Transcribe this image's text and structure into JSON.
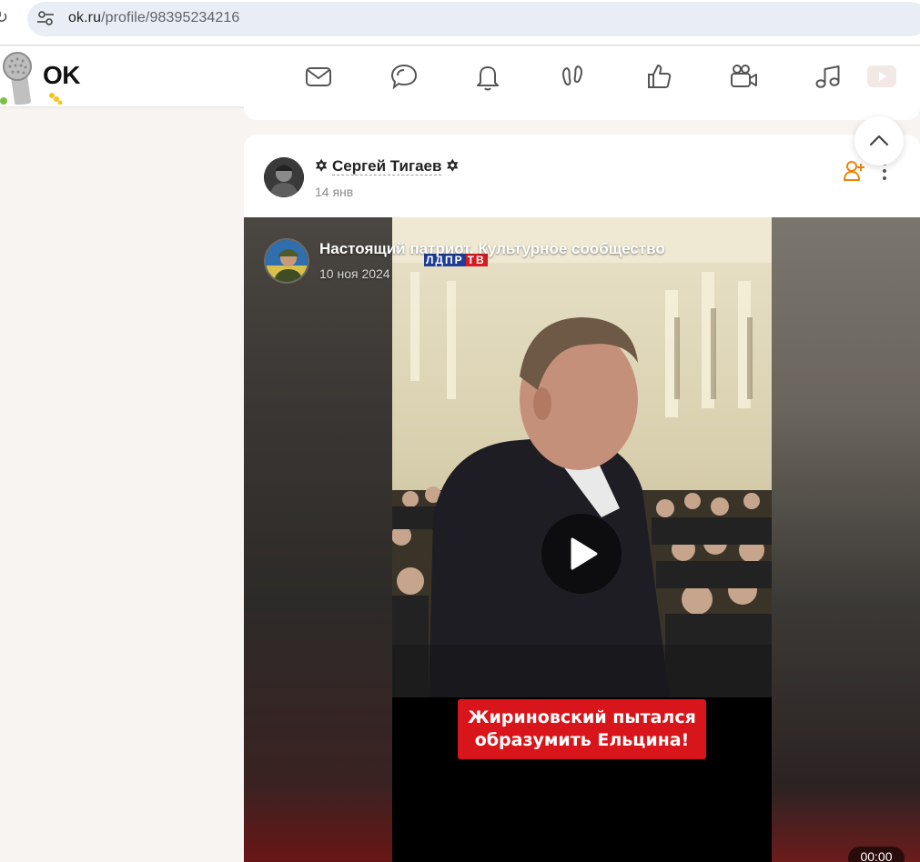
{
  "browser": {
    "url_domain": "ok.ru",
    "url_path": "/profile/98395234216"
  },
  "header": {
    "logo_text": "OK",
    "nav_icons": [
      "mail-icon",
      "discussions-icon",
      "notifications-icon",
      "guests-icon",
      "likes-icon",
      "video-icon",
      "music-icon",
      "video-tab-icon"
    ]
  },
  "post": {
    "author_name": "Сергей Тигаев",
    "author_decoration": "✡",
    "date": "14 янв",
    "video": {
      "group_name": "Настоящий патриот. Культурное сообщество",
      "group_date": "10 ноя 2024",
      "tv_badge_a": "ЛДПР",
      "tv_badge_b": "ТВ",
      "caption_line1": "Жириновский пытался",
      "caption_line2": "образумить Ельцина!",
      "duration": "00:00"
    }
  },
  "colors": {
    "accent": "#ee8208",
    "caption_red": "#d8151a",
    "page_bg": "#f7f4f1"
  }
}
